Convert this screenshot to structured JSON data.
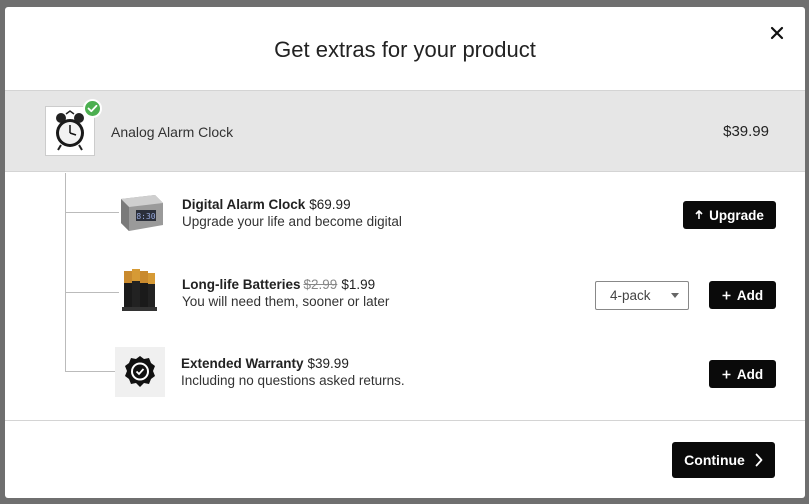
{
  "modal": {
    "title": "Get extras for your product"
  },
  "main_product": {
    "name": "Analog Alarm Clock",
    "price": "$39.99"
  },
  "extras": [
    {
      "name": "Digital Alarm Clock",
      "price": "$69.99",
      "description": "Upgrade your life and become digital",
      "action_label": "Upgrade",
      "action_icon": "arrow-up-icon"
    },
    {
      "name": "Long-life Batteries",
      "old_price": "$2.99",
      "price": "$1.99",
      "description": "You will need them, sooner or later",
      "select_value": "4-pack",
      "action_label": "Add",
      "action_icon": "plus-icon"
    },
    {
      "name": "Extended Warranty",
      "price": "$39.99",
      "description": "Including no questions asked returns.",
      "action_label": "Add",
      "action_icon": "plus-icon"
    }
  ],
  "footer": {
    "continue_label": "Continue"
  },
  "colors": {
    "accent": "#0a0a0a",
    "check": "#4caf50",
    "main_row_bg": "#e6e6e6"
  }
}
